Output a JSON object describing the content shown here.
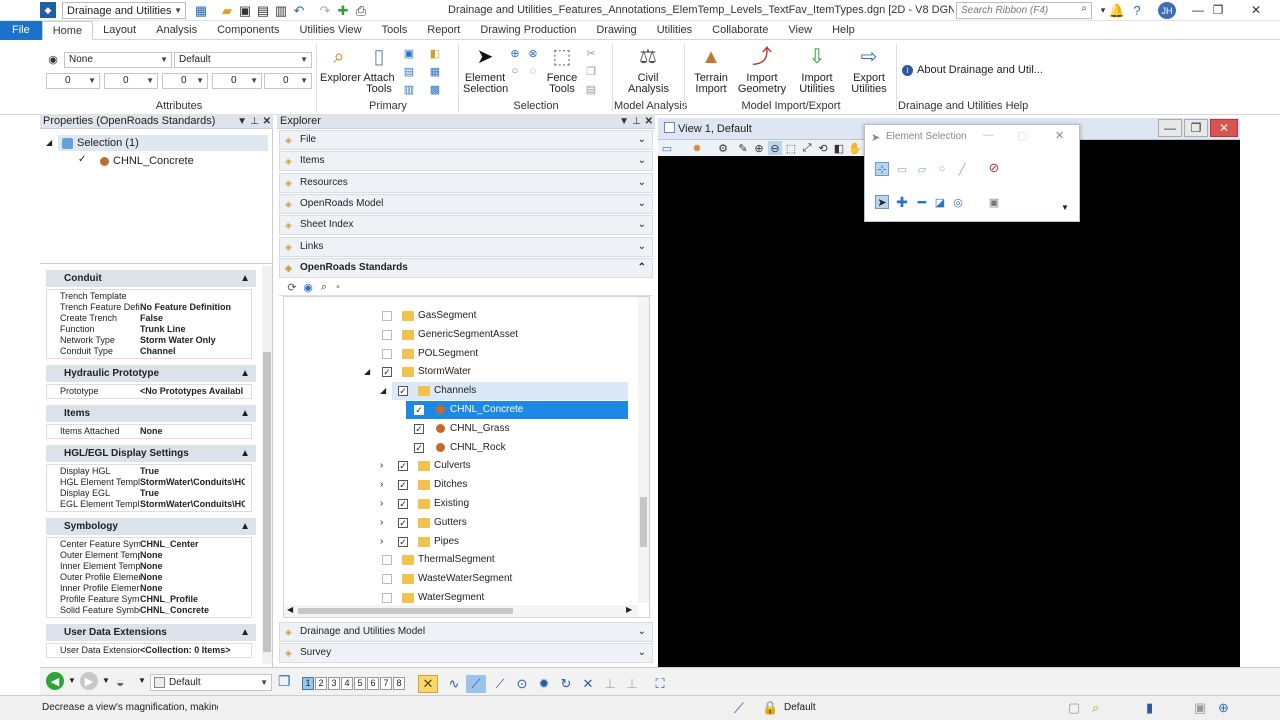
{
  "title_bar": {
    "workspace": "Drainage and Utilities",
    "window_title": "Drainage and Utilities_Features_Annotations_ElemTemp_Levels_TextFav_ItemTypes.dgn [2D - V8 DGN] - OpenRoads Design",
    "search_placeholder": "Search Ribbon (F4)",
    "user_initials": "JH"
  },
  "tabs": [
    "File",
    "Home",
    "Layout",
    "Analysis",
    "Components",
    "Utilities View",
    "Tools",
    "Report",
    "Drawing Production",
    "Drawing",
    "Utilities",
    "Collaborate",
    "View",
    "Help"
  ],
  "ribbon": {
    "attributes": {
      "level": "None",
      "template": "Default",
      "color": "0",
      "weight": "0",
      "style": "0",
      "transparency": "0",
      "priority": "0",
      "label": "Attributes"
    },
    "primary": {
      "explorer": "Explorer",
      "attach_tools": "Attach Tools",
      "label": "Primary"
    },
    "selection": {
      "element_selection": "Element Selection",
      "fence_tools": "Fence Tools",
      "label": "Selection"
    },
    "model_analysis": {
      "civil_analysis": "Civil Analysis",
      "label": "Model Analysis"
    },
    "import_export": {
      "terrain_import": "Terrain Import",
      "import_geometry": "Import Geometry",
      "import_utilities": "Import Utilities",
      "export_utilities": "Export Utilities",
      "label": "Model Import/Export"
    },
    "help": {
      "about": "About Drainage and Util...",
      "label": "Drainage and Utilities Help"
    }
  },
  "properties_panel": {
    "title": "Properties (OpenRoads Standards)",
    "selection": "Selection (1)",
    "selected_item": "CHNL_Concrete",
    "sections": [
      {
        "name": "Conduit",
        "rows": [
          {
            "k": "Trench Template",
            "v": ""
          },
          {
            "k": "Trench Feature Defini",
            "v": "No Feature Definition"
          },
          {
            "k": "Create Trench",
            "v": "False"
          },
          {
            "k": "Function",
            "v": "Trunk Line"
          },
          {
            "k": "Network Type",
            "v": "Storm Water Only"
          },
          {
            "k": "Conduit Type",
            "v": "Channel"
          }
        ]
      },
      {
        "name": "Hydraulic Prototype",
        "rows": [
          {
            "k": "Prototype",
            "v": "<No Prototypes Availabl"
          }
        ]
      },
      {
        "name": "Items",
        "rows": [
          {
            "k": "Items Attached",
            "v": "None"
          }
        ]
      },
      {
        "name": "HGL/EGL Display Settings",
        "rows": [
          {
            "k": "Display HGL",
            "v": "True"
          },
          {
            "k": "HGL Element Templa",
            "v": "StormWater\\Conduits\\HG"
          },
          {
            "k": "Display EGL",
            "v": "True"
          },
          {
            "k": "EGL Element Templa",
            "v": "StormWater\\Conduits\\HG"
          }
        ]
      },
      {
        "name": "Symbology",
        "rows": [
          {
            "k": "Center Feature Symb",
            "v": "CHNL_Center"
          },
          {
            "k": "Outer Element Templ",
            "v": "None"
          },
          {
            "k": "Inner Element Templ",
            "v": "None"
          },
          {
            "k": "Outer Profile Element",
            "v": "None"
          },
          {
            "k": "Inner Profile Element",
            "v": "None"
          },
          {
            "k": "Profile Feature Symb",
            "v": "CHNL_Profile"
          },
          {
            "k": "Solid Feature Symbol",
            "v": "CHNL_Concrete"
          }
        ]
      },
      {
        "name": "User Data Extensions",
        "rows": [
          {
            "k": "User Data Extension",
            "v": "<Collection: 0 Items>"
          }
        ]
      }
    ]
  },
  "explorer": {
    "title": "Explorer",
    "sections": [
      "File",
      "Items",
      "Resources",
      "OpenRoads Model",
      "Sheet Index",
      "Links",
      "OpenRoads Standards"
    ],
    "bottom_sections": [
      "Drainage and Utilities Model",
      "Survey"
    ],
    "tree": [
      {
        "label": "GasSegment",
        "indent": 0,
        "checked": false,
        "type": "folder"
      },
      {
        "label": "GenericSegmentAsset",
        "indent": 0,
        "checked": false,
        "type": "folder"
      },
      {
        "label": "POLSegment",
        "indent": 0,
        "checked": false,
        "type": "folder"
      },
      {
        "label": "StormWater",
        "indent": 0,
        "checked": true,
        "type": "folder",
        "expander": "open"
      },
      {
        "label": "Channels",
        "indent": 1,
        "checked": true,
        "type": "folder",
        "expander": "open",
        "hover": true
      },
      {
        "label": "CHNL_Concrete",
        "indent": 2,
        "checked": true,
        "type": "item",
        "selected": true
      },
      {
        "label": "CHNL_Grass",
        "indent": 2,
        "checked": true,
        "type": "item"
      },
      {
        "label": "CHNL_Rock",
        "indent": 2,
        "checked": true,
        "type": "item"
      },
      {
        "label": "Culverts",
        "indent": 1,
        "checked": true,
        "type": "folder",
        "expander": "closed"
      },
      {
        "label": "Ditches",
        "indent": 1,
        "checked": true,
        "type": "folder",
        "expander": "closed"
      },
      {
        "label": "Existing",
        "indent": 1,
        "checked": true,
        "type": "folder",
        "expander": "closed"
      },
      {
        "label": "Gutters",
        "indent": 1,
        "checked": true,
        "type": "folder",
        "expander": "closed"
      },
      {
        "label": "Pipes",
        "indent": 1,
        "checked": true,
        "type": "folder",
        "expander": "closed"
      },
      {
        "label": "ThermalSegment",
        "indent": 0,
        "checked": false,
        "type": "folder"
      },
      {
        "label": "WasteWaterSegment",
        "indent": 0,
        "checked": false,
        "type": "folder"
      },
      {
        "label": "WaterSegment",
        "indent": 0,
        "checked": false,
        "type": "folder"
      }
    ]
  },
  "view": {
    "title": "View 1, Default"
  },
  "element_selection": {
    "title": "Element Selection"
  },
  "bottom_toolbar": {
    "view_attr": "Default",
    "views": [
      "1",
      "2",
      "3",
      "4",
      "5",
      "6",
      "7",
      "8"
    ]
  },
  "status": {
    "message": "Decrease a view's magnification, making e",
    "level": "Default"
  },
  "colors": {
    "accent": "#1a73c8",
    "selected_row": "#1e88e5",
    "panel_header": "#dbe2ea",
    "view_bg": "#000000"
  }
}
